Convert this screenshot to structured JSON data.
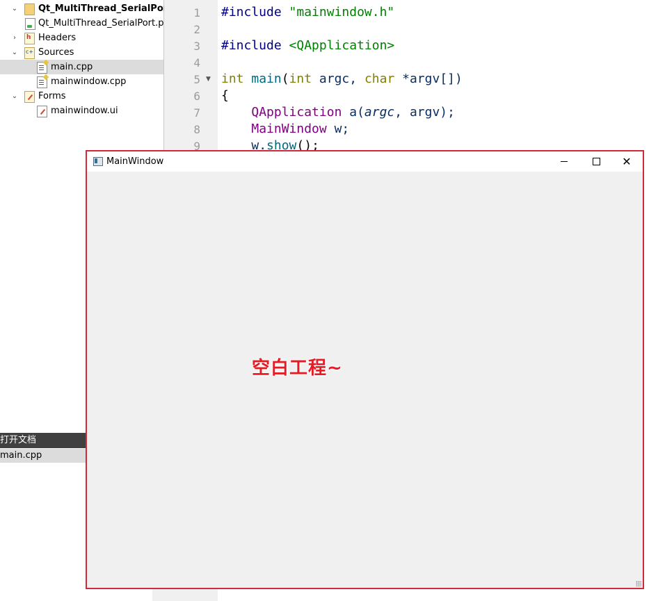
{
  "project_tree": {
    "items": [
      {
        "label": "Qt_MultiThread_SerialPort",
        "arrow": "⌄",
        "icon": "qt-project-icon"
      },
      {
        "label": "Qt_MultiThread_SerialPort.pro",
        "arrow": "",
        "icon": "pro-file-icon"
      },
      {
        "label": "Headers",
        "arrow": "›",
        "icon": "headers-folder-icon"
      },
      {
        "label": "Sources",
        "arrow": "⌄",
        "icon": "sources-folder-icon"
      },
      {
        "label": "main.cpp",
        "arrow": "",
        "icon": "cpp-file-icon"
      },
      {
        "label": "mainwindow.cpp",
        "arrow": "",
        "icon": "cpp-file-icon"
      },
      {
        "label": "Forms",
        "arrow": "⌄",
        "icon": "forms-folder-icon"
      },
      {
        "label": "mainwindow.ui",
        "arrow": "",
        "icon": "ui-file-icon"
      }
    ]
  },
  "open_documents": {
    "header": "打开文档",
    "items": [
      "main.cpp"
    ]
  },
  "editor": {
    "line_numbers": [
      "1",
      "2",
      "3",
      "4",
      "5",
      "6",
      "7",
      "8",
      "9"
    ],
    "code": {
      "l1_directive": "#include",
      "l1_file": "\"mainwindow.h\"",
      "l3_directive": "#include",
      "l3_file": "<QApplication>",
      "l5_int": "int",
      "l5_main": "main",
      "l5_open": "(",
      "l5_int2": "int",
      "l5_argc": " argc, ",
      "l5_char": "char",
      "l5_rest": " *argv[])",
      "l6_brace": "{",
      "l7_class": "QApplication",
      "l7_a": " a(",
      "l7_argc": "argc",
      "l7_rest": ", argv);",
      "l8_class": "MainWindow",
      "l8_rest": " w;",
      "l9_w": "w.",
      "l9_show": "show",
      "l9_rest": "();"
    }
  },
  "main_window": {
    "title": "MainWindow",
    "close_glyph": "✕",
    "content_text": "空白工程~"
  },
  "colors": {
    "highlight_border": "#d0293a",
    "content_text": "#e51c25"
  }
}
